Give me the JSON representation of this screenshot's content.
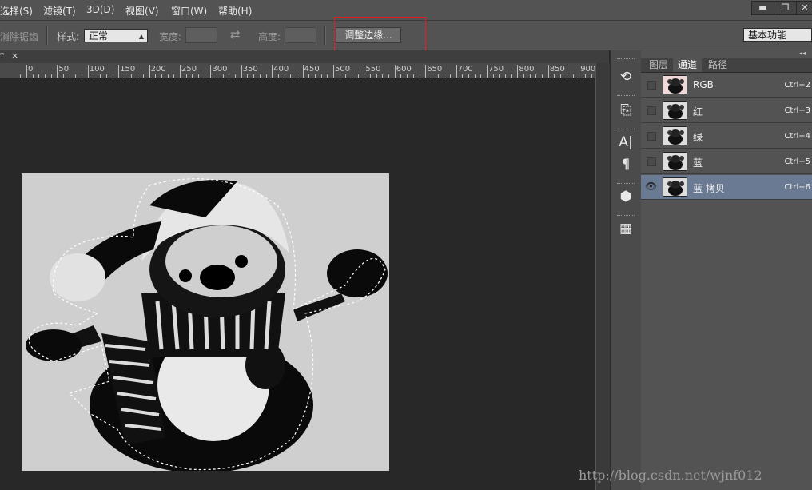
{
  "menubar": {
    "items": [
      "选择(S)",
      "滤镜(T)",
      "3D(D)",
      "视图(V)",
      "窗口(W)",
      "帮助(H)"
    ],
    "window_buttons": [
      "▬",
      "❐",
      "✕"
    ]
  },
  "options": {
    "antialias_label": "消除锯齿",
    "style_label": "样式:",
    "style_value": "正常",
    "width_label": "宽度:",
    "height_label": "高度:",
    "swap_icon": "⇄",
    "refine_edge_button": "调整边缘...",
    "workspace_value": "基本功能"
  },
  "document": {
    "tab_close": "×",
    "tab_marker": "*"
  },
  "ruler": {
    "labels": [
      "0",
      "50",
      "100",
      "150",
      "200",
      "250",
      "300",
      "350",
      "400",
      "450",
      "500",
      "550",
      "600",
      "650",
      "700",
      "750",
      "800",
      "850",
      "900"
    ]
  },
  "panel": {
    "collapse_icon": "◂◂",
    "tabs": [
      "图层",
      "通道",
      "路径"
    ],
    "active_tab": 1,
    "channels": [
      {
        "name": "RGB",
        "shortcut": "Ctrl+2",
        "visible": false,
        "selected": false
      },
      {
        "name": "红",
        "shortcut": "Ctrl+3",
        "visible": false,
        "selected": false
      },
      {
        "name": "绿",
        "shortcut": "Ctrl+4",
        "visible": false,
        "selected": false
      },
      {
        "name": "蓝",
        "shortcut": "Ctrl+5",
        "visible": false,
        "selected": false
      },
      {
        "name": "蓝 拷贝",
        "shortcut": "Ctrl+6",
        "visible": true,
        "selected": true
      }
    ],
    "eye_icon": "👁"
  },
  "toolstrip": {
    "icons": [
      "history-icon",
      "brush-preset-icon",
      "character-icon",
      "paragraph-icon",
      "3d-icon",
      "properties-icon"
    ],
    "glyphs": [
      "⟲",
      "⎘",
      "A|",
      "¶",
      "⬢",
      "▦"
    ]
  },
  "watermark": "http://blog.csdn.net/wjnf012"
}
